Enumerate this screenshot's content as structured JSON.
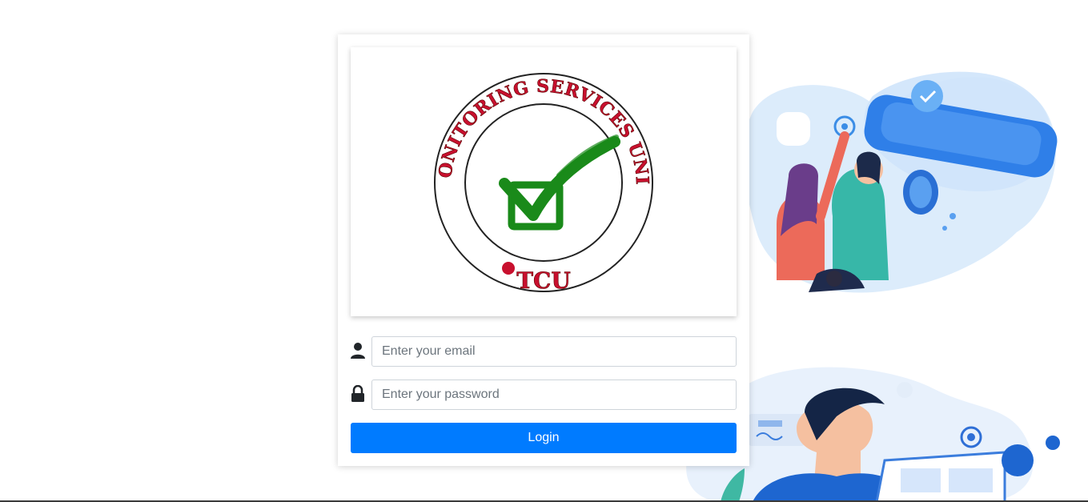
{
  "logo": {
    "ring_text": "MONITORING SERVICES UNIT",
    "bottom_text": "TCU"
  },
  "form": {
    "email_placeholder": "Enter your email",
    "password_placeholder": "Enter your password",
    "login_label": "Login"
  },
  "icons": {
    "email": "user-icon",
    "password": "lock-icon"
  },
  "colors": {
    "primary_button": "#007bff",
    "logo_red": "#c8102e",
    "logo_green": "#1a8a1a"
  }
}
